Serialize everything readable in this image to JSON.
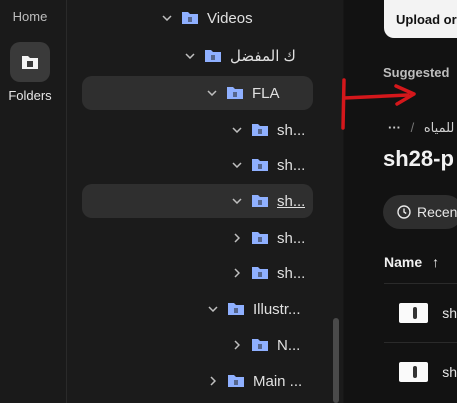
{
  "rail": {
    "home_label": "Home",
    "folders_label": "Folders"
  },
  "tree": {
    "items": [
      {
        "label": "Videos",
        "expanded": true
      },
      {
        "label": "ك المفضل",
        "expanded": true
      },
      {
        "label": "FLA",
        "expanded": true,
        "selected": true
      },
      {
        "label": "sh...",
        "expanded": true
      },
      {
        "label": "sh...",
        "expanded": true
      },
      {
        "label": "sh...",
        "expanded": true,
        "selected": true,
        "underline": true
      },
      {
        "label": "sh...",
        "expanded": false
      },
      {
        "label": "sh...",
        "expanded": false
      },
      {
        "label": "Illustr...",
        "expanded": true
      },
      {
        "label": "N...",
        "expanded": false
      },
      {
        "label": "Main ...",
        "expanded": false
      }
    ]
  },
  "main": {
    "upload_label": "Upload or",
    "suggested_label": "Suggested",
    "breadcrumb_more": "···",
    "breadcrumb_sep": "/",
    "breadcrumb_item": "للمياه",
    "title": "sh28-p",
    "recent_label": "Recen",
    "column_name": "Name",
    "sort_arrow": "↑",
    "files": [
      {
        "label": "sh"
      },
      {
        "label": "sh"
      }
    ]
  },
  "colors": {
    "annotation": "#d4171b",
    "folder": "#8fb0ff"
  },
  "icons": {
    "folders": "folder-icon",
    "recent": "clock-icon"
  }
}
